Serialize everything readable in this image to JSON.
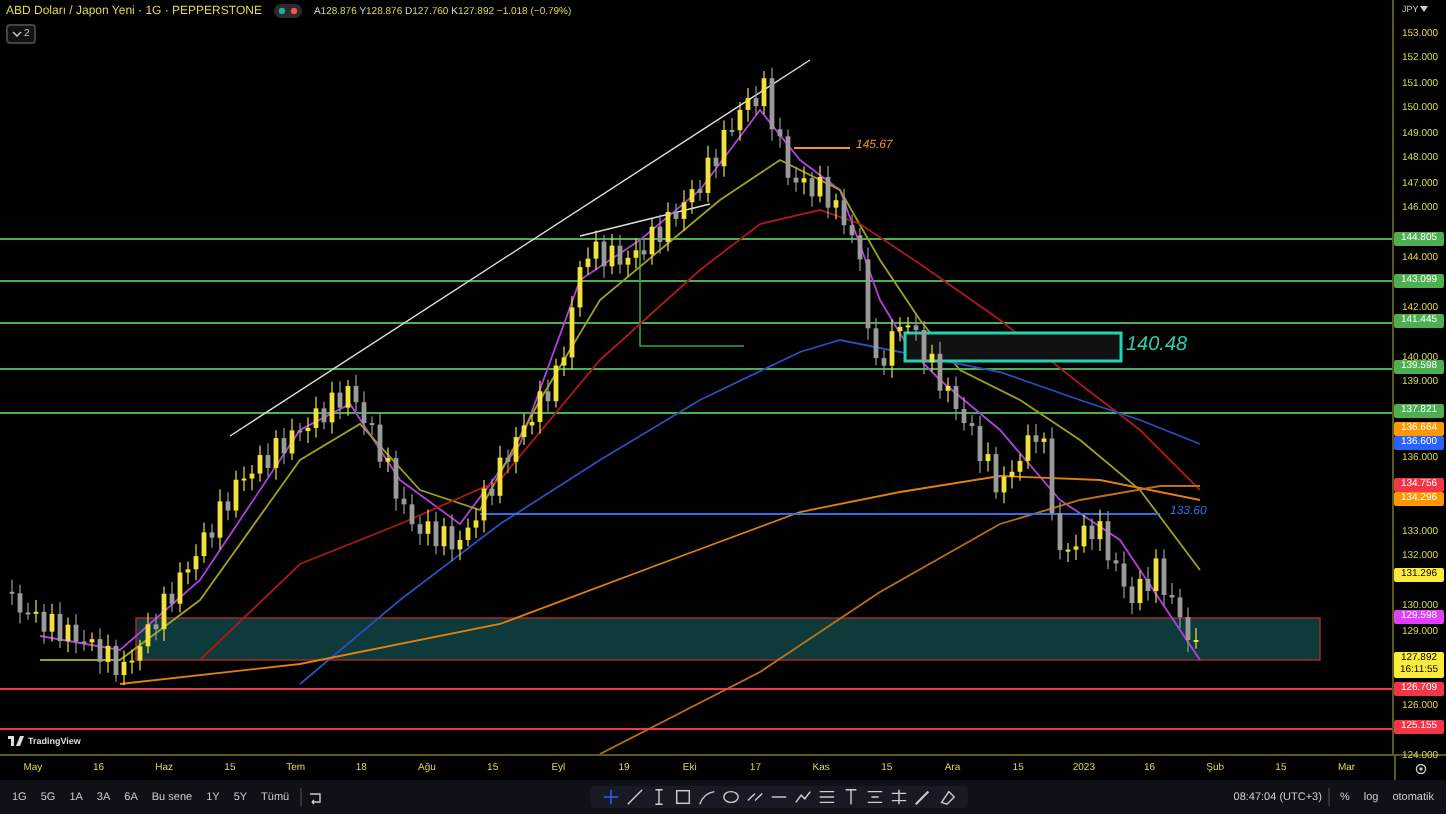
{
  "header": {
    "title": "ABD Doları / Japon Yeni · 1G · PEPPERSTONE",
    "ohlc": [
      {
        "label": "A",
        "value": "128.876"
      },
      {
        "label": "Y",
        "value": "128.876"
      },
      {
        "label": "D",
        "value": "127.760"
      },
      {
        "label": "K",
        "value": "127.892"
      }
    ],
    "change": "−1.018 (−0.79%)",
    "indicators_count": "2"
  },
  "annotations": [
    {
      "kind": "line",
      "text": "145.67",
      "color": "#f7931a"
    },
    {
      "kind": "box",
      "text": "140.48",
      "color": "#22d3b0"
    },
    {
      "kind": "line",
      "text": "133.60",
      "color": "#2f6fe8"
    }
  ],
  "price_axis": {
    "currency": "JPY",
    "labels": [
      "153.000",
      "152.000",
      "151.000",
      "150.000",
      "149.000",
      "148.000",
      "147.000",
      "146.000",
      "144.000",
      "142.000",
      "140.000",
      "139.000",
      "136.000",
      "133.000",
      "132.000",
      "130.000",
      "129.000",
      "126.000",
      "124.000"
    ]
  },
  "price_tags": [
    {
      "label": "144.805",
      "color": "#4caf50",
      "line": true
    },
    {
      "label": "143.099",
      "color": "#4caf50",
      "line": true
    },
    {
      "label": "141.445",
      "color": "#4caf50",
      "line": true
    },
    {
      "label": "139.598",
      "color": "#4caf50",
      "line": true
    },
    {
      "label": "137.821",
      "color": "#4caf50",
      "line": true
    },
    {
      "label": "136.664",
      "color": "#ff9800",
      "line": false
    },
    {
      "label": "136.600",
      "color": "#2962ff",
      "line": false
    },
    {
      "label": "134.756",
      "color": "#f23645",
      "line": false
    },
    {
      "label": "134.296",
      "color": "#ff9800",
      "line": false
    },
    {
      "label": "131.296",
      "color": "#ffeb3b",
      "line": false
    },
    {
      "label": "129.598",
      "color": "#e040fb",
      "line": false
    },
    {
      "label": "127.892",
      "color": "#ffeb3b",
      "line": false,
      "countdown": "16:11:55"
    },
    {
      "label": "126.709",
      "color": "#f23645",
      "line": true
    },
    {
      "label": "125.155",
      "color": "#f23645",
      "line": true
    }
  ],
  "time_axis": [
    "May",
    "16",
    "Haz",
    "15",
    "Tem",
    "18",
    "Ağu",
    "15",
    "Eyl",
    "19",
    "Eki",
    "17",
    "Kas",
    "15",
    "Ara",
    "15",
    "2023",
    "16",
    "Şub",
    "15",
    "Mar"
  ],
  "logo": "TradingView",
  "ranges": [
    "1G",
    "5G",
    "1A",
    "3A",
    "6A",
    "Bu sene",
    "1Y",
    "5Y",
    "Tümü"
  ],
  "clock": "08:47:04 (UTC+3)",
  "scale_buttons": [
    {
      "label": "%",
      "selected": false
    },
    {
      "label": "log",
      "selected": false
    },
    {
      "label": "otomatik",
      "selected": false
    }
  ]
}
